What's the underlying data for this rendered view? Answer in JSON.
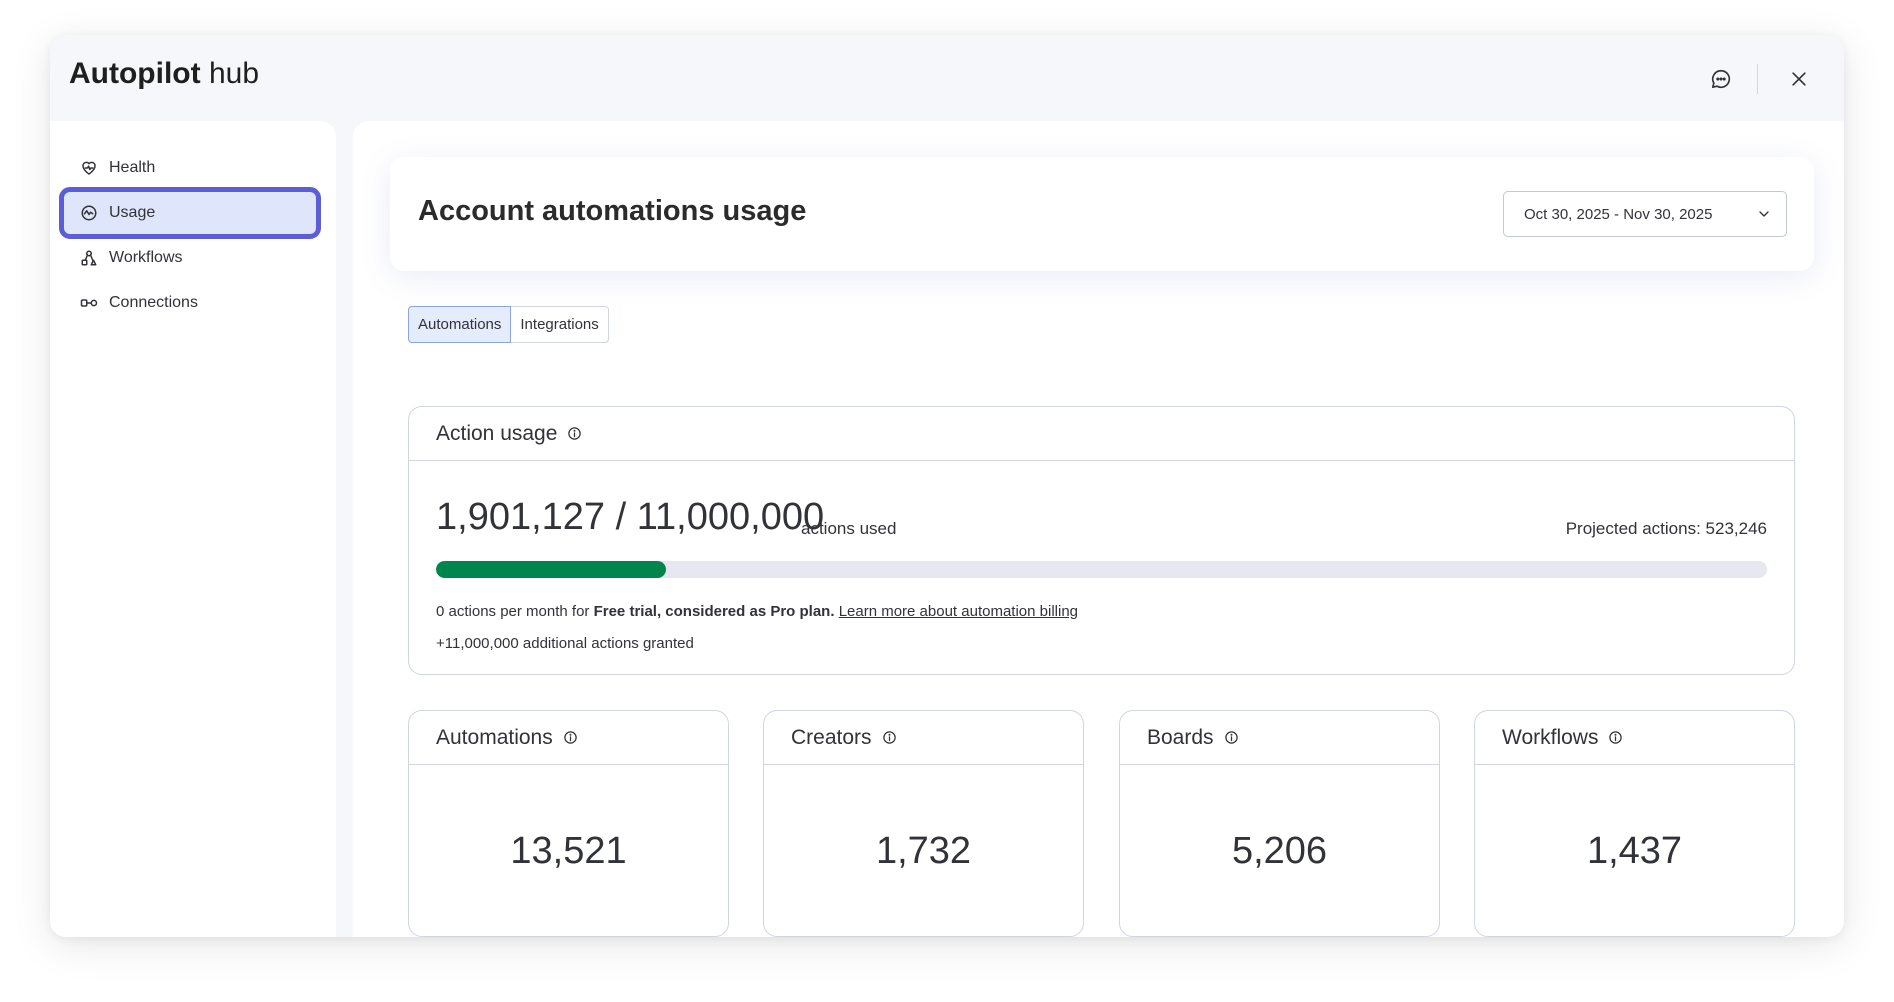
{
  "window": {
    "title_bold": "Autopilot",
    "title_rest": "hub"
  },
  "header": {
    "feedback_icon": "chat-feedback-icon",
    "close_icon": "close-icon"
  },
  "sidebar": {
    "items": [
      {
        "label": "Health",
        "icon": "heart-pulse-icon",
        "active": false
      },
      {
        "label": "Usage",
        "icon": "gauge-icon",
        "active": true
      },
      {
        "label": "Workflows",
        "icon": "workflow-icon",
        "active": false
      },
      {
        "label": "Connections",
        "icon": "link-icon",
        "active": false
      }
    ]
  },
  "main": {
    "page_title": "Account automations usage",
    "date_range": "Oct 30, 2025 - Nov 30, 2025",
    "tabs": [
      {
        "label": "Automations",
        "active": true
      },
      {
        "label": "Integrations",
        "active": false
      }
    ],
    "action_usage": {
      "title": "Action usage",
      "used_display": "1,901,127 / 11,000,000",
      "used_suffix": "actions used",
      "projected": "Projected actions: 523,246",
      "progress_fraction": 0.1728,
      "billing_prefix": "0 actions per month for ",
      "billing_plan": "Free trial, considered as Pro plan.",
      "billing_link": "Learn more about automation billing",
      "granted": "+11,000,000 additional actions granted"
    },
    "stats": [
      {
        "title": "Automations",
        "value": "13,521"
      },
      {
        "title": "Creators",
        "value": "1,732"
      },
      {
        "title": "Boards",
        "value": "5,206"
      },
      {
        "title": "Workflows",
        "value": "1,437"
      }
    ]
  },
  "colors": {
    "accent": "#5c5ed6",
    "progress": "#00854d",
    "active_bg": "#dfe6fb"
  }
}
